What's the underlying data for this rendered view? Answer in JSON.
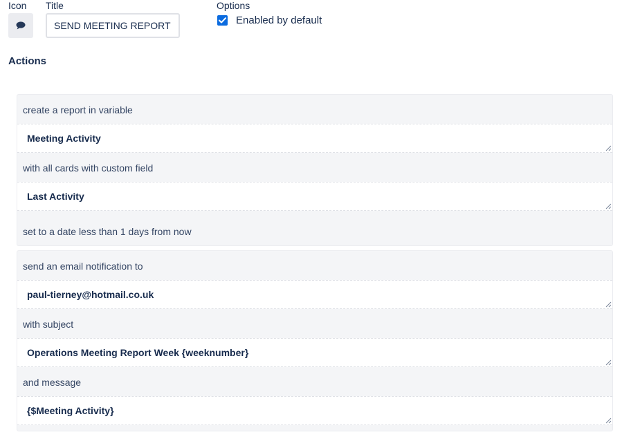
{
  "header": {
    "icon_label": "Icon",
    "title_label": "Title",
    "options_label": "Options",
    "icon_name": "speech-bubble-icon",
    "title_value": "SEND MEETING REPORT",
    "enabled_by_default_label": "Enabled by default",
    "enabled_by_default_checked": true
  },
  "actions_heading": "Actions",
  "actions": [
    {
      "parts": [
        {
          "type": "text",
          "value": "create a report in variable"
        },
        {
          "type": "field",
          "value": "Meeting Activity"
        },
        {
          "type": "text",
          "value": "with all cards with custom field"
        },
        {
          "type": "field",
          "value": "Last Activity"
        },
        {
          "type": "text",
          "value": "set to a date less than 1 days from now"
        }
      ]
    },
    {
      "parts": [
        {
          "type": "text",
          "value": "send an email notification to"
        },
        {
          "type": "field",
          "value": "paul-tierney@hotmail.co.uk"
        },
        {
          "type": "text",
          "value": "with subject"
        },
        {
          "type": "field",
          "value": "Operations Meeting Report Week {weeknumber}"
        },
        {
          "type": "text",
          "value": "and message"
        },
        {
          "type": "field",
          "value": "{$Meeting Activity}"
        }
      ]
    }
  ],
  "colors": {
    "checkbox_accent": "#0b6bdf",
    "card_background": "#f4f5f7",
    "text_primary": "#172b4d"
  }
}
